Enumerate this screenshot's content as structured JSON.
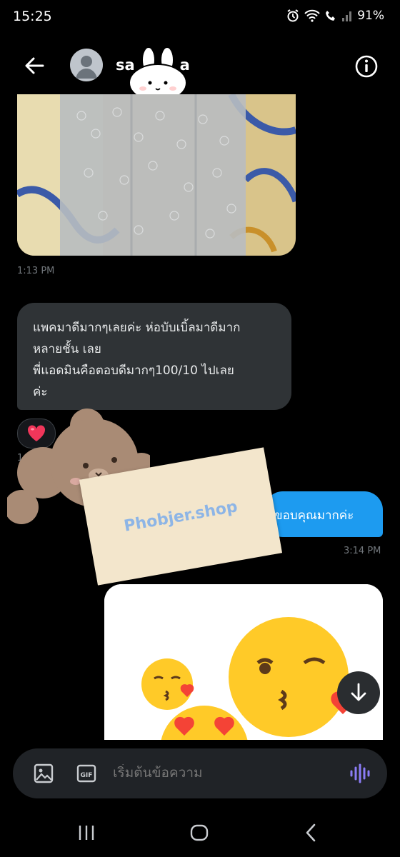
{
  "status_bar": {
    "time": "15:25",
    "battery": "91%"
  },
  "header": {
    "contact_name": "sa   a"
  },
  "messages": {
    "media_timestamp": "1:13 PM",
    "incoming_text": "แพคมาดีมากๆเลยค่ะ ห่อบับเบิ้ลมาดีมาก\nหลายชั้น เลย\nพี่แอดมินคือตอบดีมากๆ100/10 ไปเลย\nค่ะ",
    "reaction": "❤️",
    "incoming_timestamp": "1:14 PM",
    "outgoing_text": "ขอบคุณมากค่ะ",
    "outgoing_timestamp": "3:14 PM"
  },
  "sticker": {
    "card_text": "Phobjer.shop"
  },
  "composer": {
    "placeholder": "เริ่มต้นข้อความ",
    "gif_label": "GIF"
  },
  "colors": {
    "accent": "#1d9bf0",
    "bubble_incoming": "#2f3336",
    "background": "#000000"
  }
}
